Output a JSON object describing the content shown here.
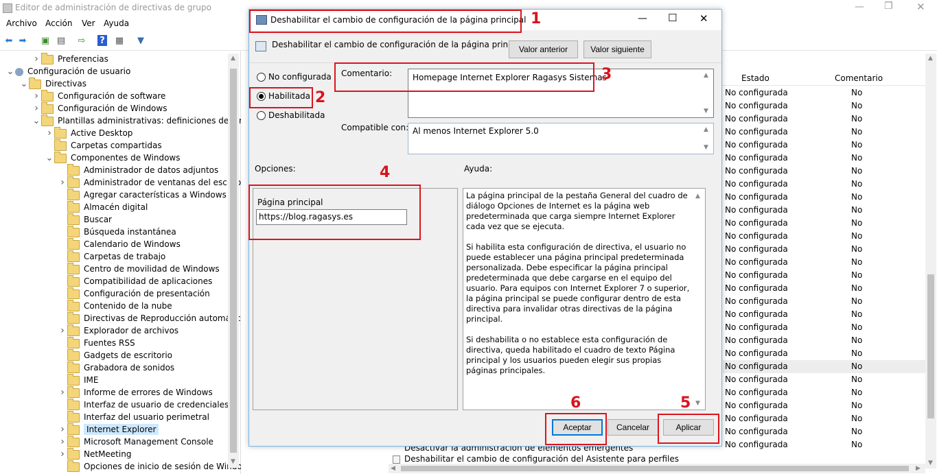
{
  "main_window": {
    "title": "Editor de administración de directivas de grupo",
    "menu": [
      "Archivo",
      "Acción",
      "Ver",
      "Ayuda"
    ]
  },
  "tree": [
    {
      "label": "Preferencias",
      "level": 2,
      "exp": ">"
    },
    {
      "label": "Configuración de usuario",
      "level": 0,
      "exp": "v",
      "icon": "user"
    },
    {
      "label": "Directivas",
      "level": 1,
      "exp": "v"
    },
    {
      "label": "Configuración de software",
      "level": 2,
      "exp": ">"
    },
    {
      "label": "Configuración de Windows",
      "level": 2,
      "exp": ">"
    },
    {
      "label": "Plantillas administrativas: definiciones de direct",
      "level": 2,
      "exp": "v"
    },
    {
      "label": "Active Desktop",
      "level": 3,
      "exp": ">"
    },
    {
      "label": "Carpetas compartidas",
      "level": 3,
      "exp": ""
    },
    {
      "label": "Componentes de Windows",
      "level": 3,
      "exp": "v"
    },
    {
      "label": "Administrador de datos adjuntos",
      "level": 4,
      "exp": ""
    },
    {
      "label": "Administrador de ventanas del escritoric",
      "level": 4,
      "exp": ">"
    },
    {
      "label": "Agregar características a Windows 10",
      "level": 4,
      "exp": ""
    },
    {
      "label": "Almacén digital",
      "level": 4,
      "exp": ""
    },
    {
      "label": "Buscar",
      "level": 4,
      "exp": ""
    },
    {
      "label": "Búsqueda instantánea",
      "level": 4,
      "exp": ""
    },
    {
      "label": "Calendario de Windows",
      "level": 4,
      "exp": ""
    },
    {
      "label": "Carpetas de trabajo",
      "level": 4,
      "exp": ""
    },
    {
      "label": "Centro de movilidad de Windows",
      "level": 4,
      "exp": ""
    },
    {
      "label": "Compatibilidad de aplicaciones",
      "level": 4,
      "exp": ""
    },
    {
      "label": "Configuración de presentación",
      "level": 4,
      "exp": ""
    },
    {
      "label": "Contenido de la nube",
      "level": 4,
      "exp": ""
    },
    {
      "label": "Directivas de Reproducción automática",
      "level": 4,
      "exp": ""
    },
    {
      "label": "Explorador de archivos",
      "level": 4,
      "exp": ">"
    },
    {
      "label": "Fuentes RSS",
      "level": 4,
      "exp": ""
    },
    {
      "label": "Gadgets de escritorio",
      "level": 4,
      "exp": ""
    },
    {
      "label": "Grabadora de sonidos",
      "level": 4,
      "exp": ""
    },
    {
      "label": "IME",
      "level": 4,
      "exp": ""
    },
    {
      "label": "Informe de errores de Windows",
      "level": 4,
      "exp": ">"
    },
    {
      "label": "Interfaz de usuario de credenciales",
      "level": 4,
      "exp": ""
    },
    {
      "label": "Interfaz del usuario perimetral",
      "level": 4,
      "exp": ""
    },
    {
      "label": "Internet Explorer",
      "level": 4,
      "exp": ">",
      "selected": true
    },
    {
      "label": "Microsoft Management Console",
      "level": 4,
      "exp": ">"
    },
    {
      "label": "NetMeeting",
      "level": 4,
      "exp": ">"
    },
    {
      "label": "Opciones de inicio de sesión de Window",
      "level": 4,
      "exp": ""
    }
  ],
  "list": {
    "col_estado": "Estado",
    "col_comentario": "Comentario",
    "row_estado": "No configurada",
    "row_comentario": "No",
    "rows": 28,
    "bottom_items": [
      "Desactivar la administración de elementos emergentes",
      "Deshabilitar el cambio de configuración del Asistente para perfiles"
    ]
  },
  "dialog": {
    "title": "Deshabilitar el cambio de configuración de la página principal",
    "subtitle": "Deshabilitar el cambio de configuración de la página principal",
    "prev_button": "Valor anterior",
    "next_button": "Valor siguiente",
    "radio_not_configured": "No configurada",
    "radio_enabled": "Habilitada",
    "radio_disabled": "Deshabilitada",
    "comment_label": "Comentario:",
    "comment_value": "Homepage Internet Explorer Ragasys Sistemas",
    "supported_label": "Compatible con:",
    "supported_value": "Al menos Internet Explorer 5.0",
    "options_label": "Opciones:",
    "help_label": "Ayuda:",
    "homepage_label": "Página principal",
    "homepage_value": "https://blog.ragasys.es",
    "help_p1": "La página principal de la pestaña General del cuadro de diálogo Opciones de Internet es la página web predeterminada que carga siempre Internet Explorer cada vez que se ejecuta.",
    "help_p2": "Si habilita esta configuración de directiva, el usuario no puede establecer una página principal predeterminada personalizada. Debe especificar la página principal predeterminada que debe cargarse en el equipo del usuario. Para equipos con Internet Explorer 7 o superior, la página principal se puede configurar dentro de esta directiva para invalidar otras directivas de la página principal.",
    "help_p3": "Si deshabilita o no establece esta configuración de directiva, queda habilitado el cuadro de texto Página principal y los usuarios pueden elegir sus propias páginas principales.",
    "ok_button": "Aceptar",
    "cancel_button": "Cancelar",
    "apply_button": "Aplicar"
  },
  "annotations": [
    "1",
    "2",
    "3",
    "4",
    "5",
    "6"
  ],
  "colors": {
    "annotation_red": "#d9141e",
    "selection": "#cde8ff",
    "focus_blue": "#0078d7"
  }
}
